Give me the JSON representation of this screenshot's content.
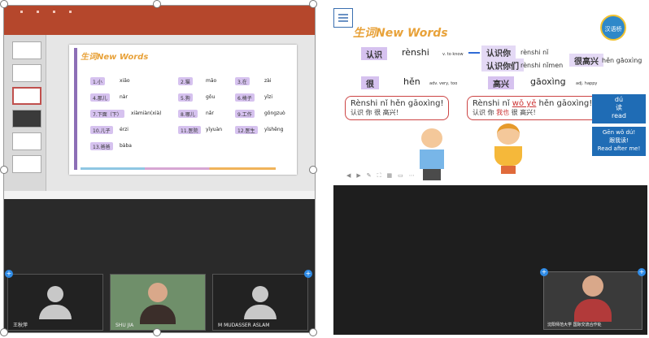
{
  "left": {
    "slide": {
      "title": "生词New Words",
      "words": [
        {
          "n": "1.小",
          "py": "xiǎo"
        },
        {
          "n": "2.猫",
          "py": "māo"
        },
        {
          "n": "3.在",
          "py": "zài"
        },
        {
          "n": "4.那儿",
          "py": "nàr"
        },
        {
          "n": "5.狗",
          "py": "gǒu"
        },
        {
          "n": "6.椅子",
          "py": "yǐzi"
        },
        {
          "n": "7.下面（下）",
          "py": "xiàmiàn(xià)"
        },
        {
          "n": "8.哪儿",
          "py": "nǎr"
        },
        {
          "n": "9.工作",
          "py": "gōngzuò"
        },
        {
          "n": "10.儿子",
          "py": "érzi"
        },
        {
          "n": "11.医院",
          "py": "yīyuàn"
        },
        {
          "n": "12.医生",
          "py": "yīshēng"
        },
        {
          "n": "13.爸爸",
          "py": "bàba"
        }
      ]
    },
    "participants": [
      {
        "name": "王秋萍"
      },
      {
        "name": "SHU JIA"
      },
      {
        "name": "M MUDASSER ASLAM"
      }
    ]
  },
  "right": {
    "title": "生词New Words",
    "logo": "汉语桥",
    "rows": {
      "renshi": {
        "hz": "认识",
        "py": "rènshi",
        "pos": "v. to know"
      },
      "renshi_ni": {
        "hz": "认识你",
        "py": "rènshi nǐ"
      },
      "renshi_nimen": {
        "hz": "认识你们",
        "py": "rènshi nǐmen"
      },
      "hengaoxing": {
        "hz": "很高兴",
        "py": "hěn gāoxìng"
      },
      "hen": {
        "hz": "很",
        "py": "hěn",
        "pos": "adv. very, too"
      },
      "gaoxing": {
        "hz": "高兴",
        "py": "gāoxìng",
        "pos": "adj. happy"
      }
    },
    "bubble1": {
      "py": "Rènshi  nǐ  hěn gāoxìng!",
      "hz": "认识  你  很   高兴！"
    },
    "bubble2": {
      "py_a": "Rènshi  nǐ  ",
      "py_red": "wǒ yě",
      "py_b": "  hěn gāoxìng!",
      "hz_a": "认识  你  ",
      "hz_red": "我也",
      "hz_b": "  很   高兴！"
    },
    "du": {
      "py": "dú",
      "hz": "读",
      "en": "read"
    },
    "gen": {
      "py": "Gēn wǒ dú!",
      "hz": "跟我读!",
      "en": "Read after me!"
    },
    "cam_name": "沈阳师范大学 国际交流合作处"
  }
}
